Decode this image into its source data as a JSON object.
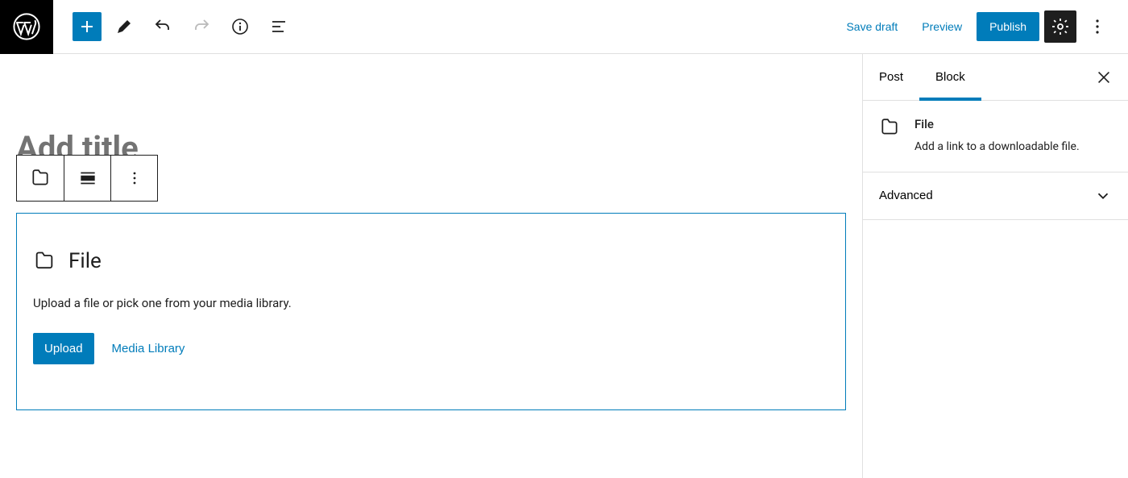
{
  "header": {
    "save_draft": "Save draft",
    "preview": "Preview",
    "publish": "Publish"
  },
  "editor": {
    "title_placeholder": "Add title",
    "file_block": {
      "title": "File",
      "description": "Upload a file or pick one from your media library.",
      "upload_label": "Upload",
      "media_library_label": "Media Library"
    }
  },
  "sidebar": {
    "tabs": {
      "post": "Post",
      "block": "Block"
    },
    "block_info": {
      "title": "File",
      "description": "Add a link to a downloadable file."
    },
    "panels": {
      "advanced": "Advanced"
    }
  }
}
